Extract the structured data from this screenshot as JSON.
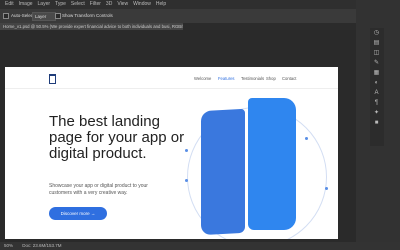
{
  "menubar": {
    "items": [
      "Edit",
      "Image",
      "Layer",
      "Type",
      "Select",
      "Filter",
      "3D",
      "View",
      "Window",
      "Help"
    ]
  },
  "options": {
    "auto_select_label": "Auto-Select:",
    "auto_select_value": "Layer",
    "show_transform_label": "Show Transform Controls"
  },
  "document": {
    "tab_title": "Home_v1.psd @ 50.5% (We provide expert financial advice to both individuals and busi, RGB/8#) *"
  },
  "site": {
    "nav": [
      "Welcome",
      "Features",
      "Testimonials",
      "Shop",
      "Contact"
    ],
    "active_nav": "Features",
    "hero_title": "The best landing page for your app or digital product.",
    "hero_sub": "Showcase your app or digital product to your customers with a very creative way.",
    "cta_label": "Discover more  →"
  },
  "status": {
    "zoom": "50%",
    "doc_info": "Doc: 23.6M/153.7M"
  },
  "colors": {
    "accent": "#2f6fe0",
    "phone_left": "#3a78de",
    "phone_right": "#2f86ef"
  }
}
